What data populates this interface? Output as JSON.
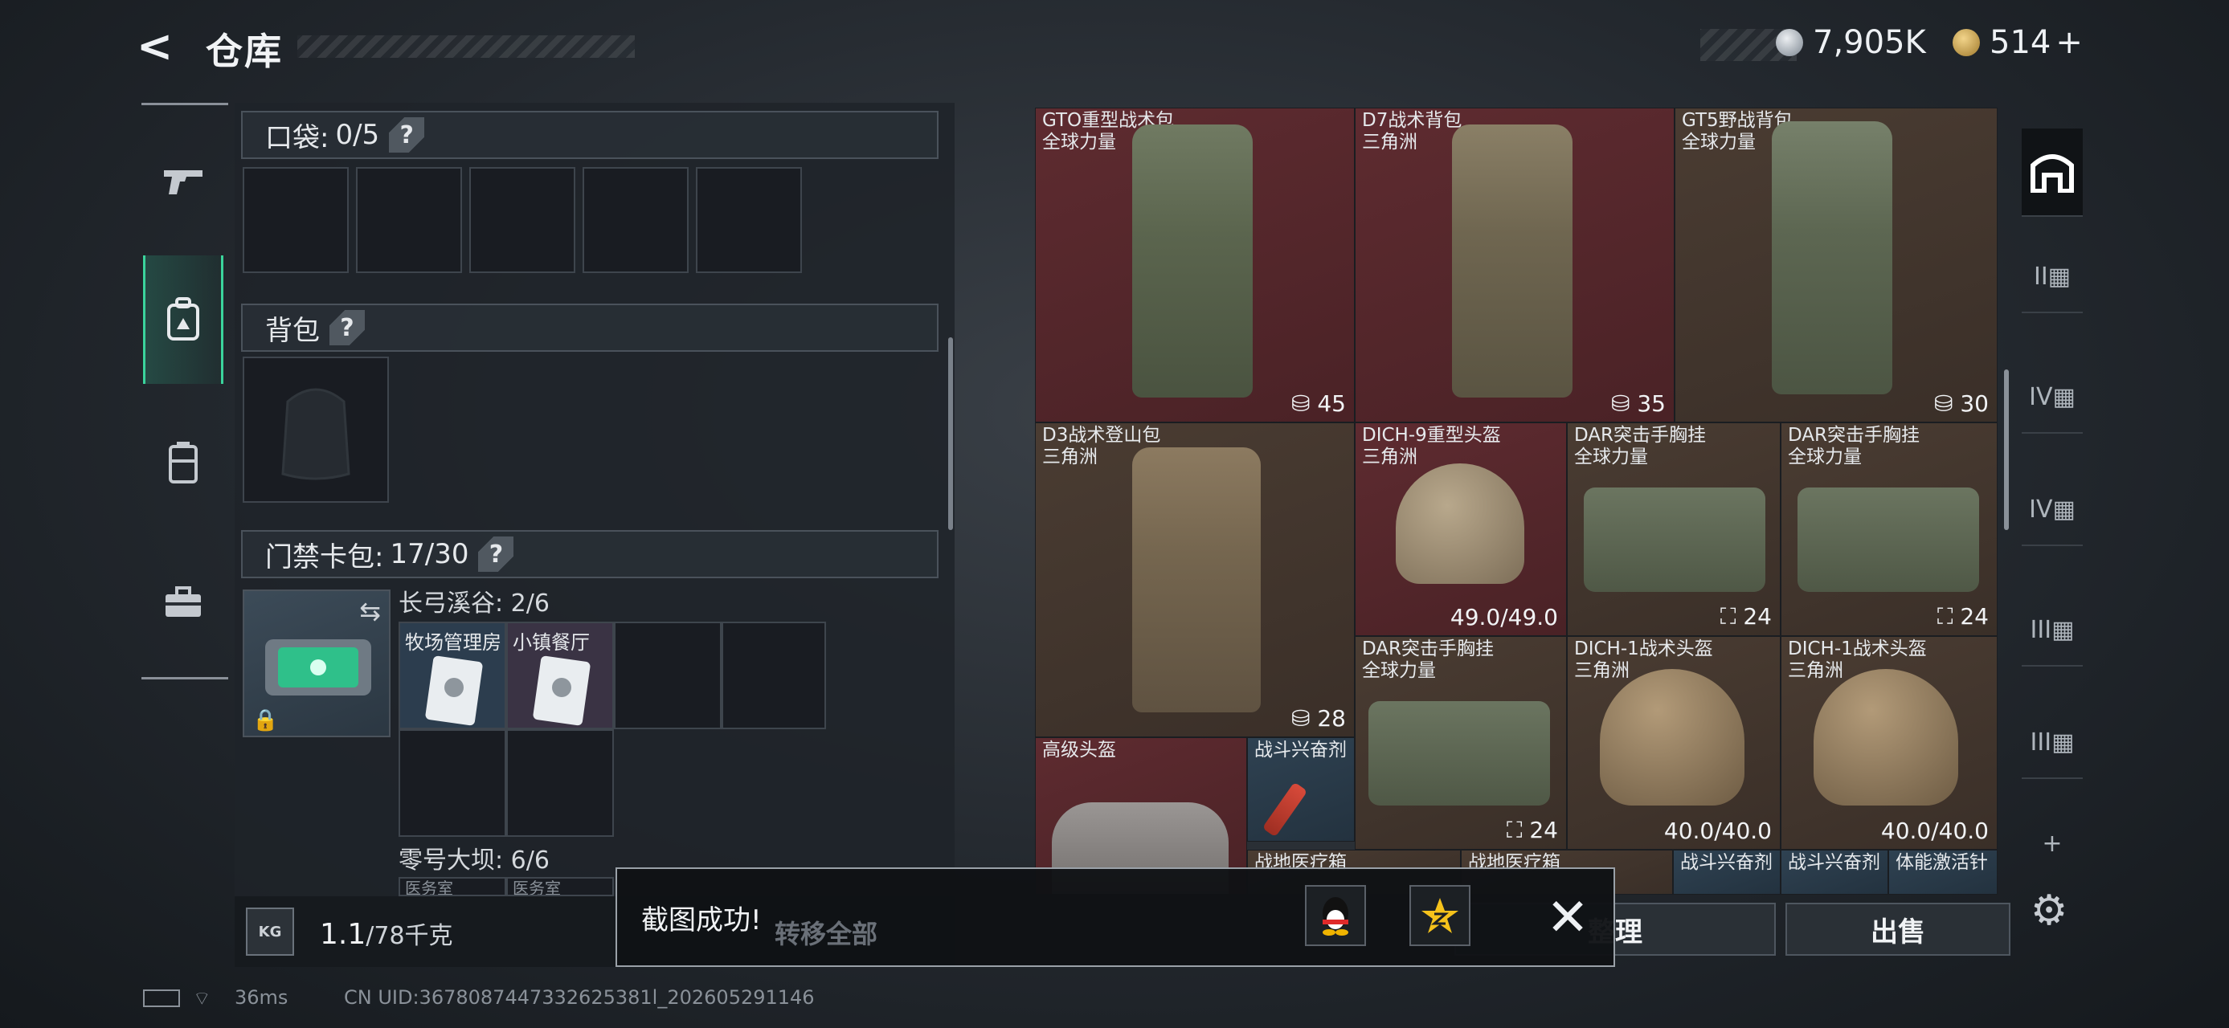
{
  "header": {
    "back_glyph": "<",
    "title": "仓库"
  },
  "currency": {
    "silver": "7,905K",
    "gold": "514",
    "add": "+"
  },
  "left_rail": {
    "items": [
      "gun-icon",
      "backpack-icon",
      "vest-icon",
      "case-icon"
    ],
    "active_index": 1
  },
  "pockets": {
    "label": "口袋:",
    "count": "0/5",
    "help": "?"
  },
  "backpack": {
    "label": "背包",
    "help": "?"
  },
  "keycard": {
    "label": "门禁卡包:",
    "count": "17/30",
    "help": "?",
    "groups": [
      {
        "name": "长弓溪谷:",
        "count": "2/6",
        "cards": [
          "牧场管理房",
          "小镇餐厅"
        ]
      },
      {
        "name": "零号大坝:",
        "count": "6/6",
        "cards": [
          "医务室",
          "医务室"
        ]
      }
    ]
  },
  "weight": {
    "icon": "KG",
    "value": "1.1",
    "max": "/78千克"
  },
  "items": [
    {
      "name": "GTO重型战术包",
      "sub": "全球力量",
      "value": "45",
      "kind": "space"
    },
    {
      "name": "D7战术背包",
      "sub": "三角洲",
      "value": "35",
      "kind": "space"
    },
    {
      "name": "GT5野战背包",
      "sub": "全球力量",
      "value": "30",
      "kind": "space"
    },
    {
      "name": "D3战术登山包",
      "sub": "三角洲",
      "value": "28",
      "kind": "space"
    },
    {
      "name": "DICH-9重型头盔",
      "sub": "三角洲",
      "value": "49.0/49.0",
      "kind": "durability"
    },
    {
      "name": "DAR突击手胸挂",
      "sub": "全球力量",
      "value": "24",
      "kind": "vest"
    },
    {
      "name": "DAR突击手胸挂",
      "sub": "全球力量",
      "value": "24",
      "kind": "vest"
    },
    {
      "name": "DAR突击手胸挂",
      "sub": "全球力量",
      "value": "24",
      "kind": "vest"
    },
    {
      "name": "DICH-1战术头盔",
      "sub": "三角洲",
      "value": "40.0/40.0",
      "kind": "durability"
    },
    {
      "name": "DICH-1战术头盔",
      "sub": "三角洲",
      "value": "40.0/40.0",
      "kind": "durability"
    },
    {
      "name": "高级头盔",
      "sub": "",
      "value": "",
      "kind": ""
    },
    {
      "name": "战斗兴奋剂",
      "sub": "",
      "value": "",
      "kind": ""
    }
  ],
  "partial_items": [
    "战地医疗箱",
    "战地医疗箱",
    "战斗兴奋剂",
    "战斗兴奋剂",
    "体能激活针"
  ],
  "right_rail": {
    "items": [
      "home-icon",
      "II",
      "IV",
      "IV",
      "III",
      "III"
    ],
    "add": "+"
  },
  "buttons": {
    "sort": "整理",
    "sell": "出售",
    "transfer_all": "转移全部"
  },
  "toast": {
    "text": "截图成功!"
  },
  "status_bar": {
    "ping": "36ms",
    "uid": "CN UID:3678087447332625381l_202605291146"
  }
}
